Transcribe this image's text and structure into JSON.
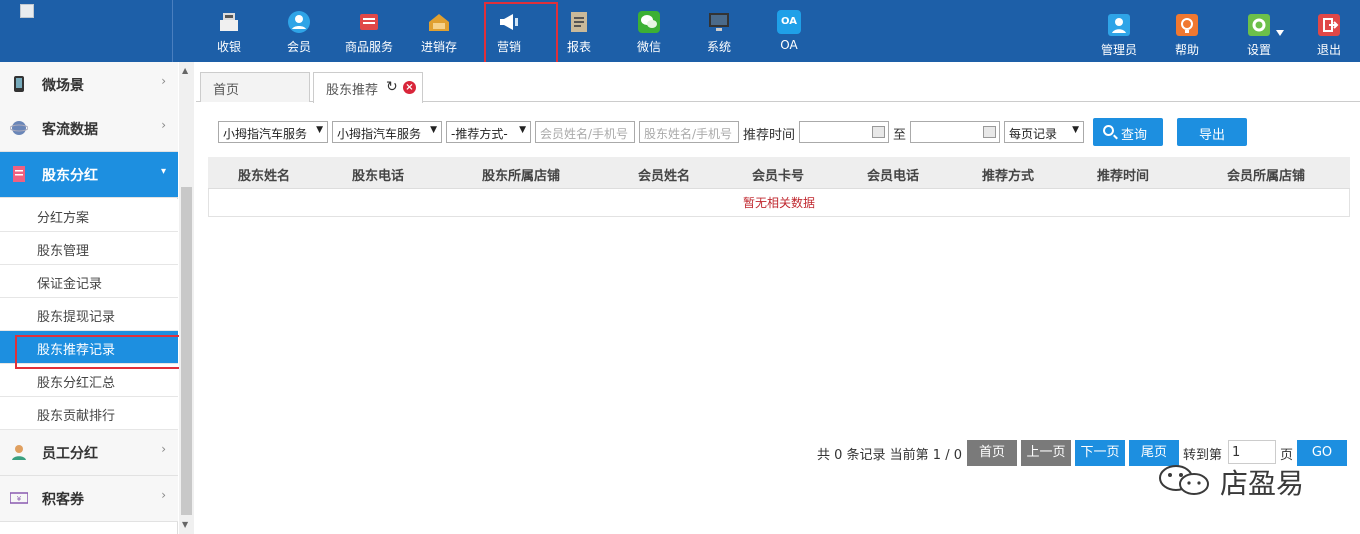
{
  "topnav": {
    "items": [
      {
        "label": "收银",
        "icon": "cash-register-icon",
        "color": "#f0f0f0"
      },
      {
        "label": "会员",
        "icon": "member-icon",
        "color": "#2fa4e7"
      },
      {
        "label": "商品服务",
        "icon": "goods-icon",
        "color": "#e04848"
      },
      {
        "label": "进销存",
        "icon": "inventory-icon",
        "color": "#e0a030"
      },
      {
        "label": "营销",
        "icon": "megaphone-icon",
        "color": "#ffffff"
      },
      {
        "label": "报表",
        "icon": "report-icon",
        "color": "#c9b99a"
      },
      {
        "label": "微信",
        "icon": "wechat-icon",
        "color": "#3cb034"
      },
      {
        "label": "系统",
        "icon": "monitor-icon",
        "color": "#333333"
      },
      {
        "label": "OA",
        "icon": "oa-icon",
        "color": "#1fa0e8",
        "icon_text": "OA"
      }
    ],
    "right": [
      {
        "label": "管理员",
        "icon": "admin-icon",
        "color": "#2fa4e7"
      },
      {
        "label": "帮助",
        "icon": "help-icon",
        "color": "#f07830"
      },
      {
        "label": "设置",
        "icon": "settings-icon",
        "color": "#6cc04a"
      },
      {
        "label": "退出",
        "icon": "logout-icon",
        "color": "#e04848"
      }
    ]
  },
  "sidebar": {
    "groups": [
      {
        "label": "微场景",
        "icon": "phone-icon"
      },
      {
        "label": "客流数据",
        "icon": "planet-icon"
      },
      {
        "label": "股东分红",
        "icon": "document-icon"
      },
      {
        "label": "员工分红",
        "icon": "staff-icon"
      },
      {
        "label": "积客券",
        "icon": "coupon-icon"
      }
    ],
    "subitems": [
      "分红方案",
      "股东管理",
      "保证金记录",
      "股东提现记录",
      "股东推荐记录",
      "股东分红汇总",
      "股东贡献排行"
    ]
  },
  "tabs": {
    "home": "首页",
    "current": "股东推荐"
  },
  "filters": {
    "store1": "小拇指汽车服务",
    "store2": "小拇指汽车服务",
    "method": "-推荐方式-",
    "member_placeholder": "会员姓名/手机号",
    "shareholder_placeholder": "股东姓名/手机号",
    "time_label": "推荐时间",
    "to_label": "至",
    "per_page": "每页记录",
    "query": "查询",
    "export": "导出"
  },
  "table": {
    "headers": [
      "股东姓名",
      "股东电话",
      "股东所属店铺",
      "会员姓名",
      "会员卡号",
      "会员电话",
      "推荐方式",
      "推荐时间",
      "会员所属店铺"
    ],
    "empty": "暂无相关数据"
  },
  "pagination": {
    "info": "共 0 条记录 当前第 1 / 0",
    "first": "首页",
    "prev": "上一页",
    "next": "下一页",
    "last": "尾页",
    "goto": "转到第",
    "page_value": "1",
    "page_unit": "页",
    "go": "GO"
  },
  "watermark": {
    "text": "店盈易"
  }
}
